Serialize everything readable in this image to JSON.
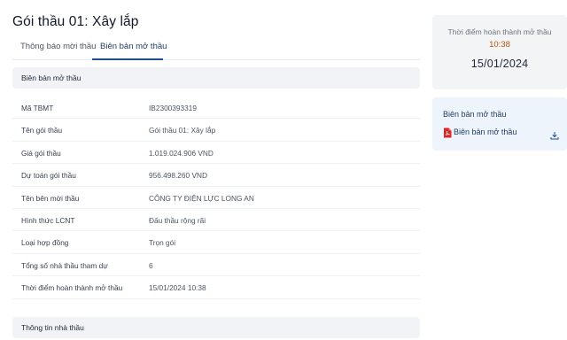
{
  "header": {
    "title": "Gói thầu 01: Xây lắp"
  },
  "tabs": [
    {
      "label": "Thông báo mời thầu",
      "active": false
    },
    {
      "label": "Biên bản mở thầu",
      "active": true
    }
  ],
  "sections": {
    "opening_minutes": "Biên bản mở thầu",
    "bidder_info": "Thông tin nhà thầu"
  },
  "details": [
    {
      "label": "Mã TBMT",
      "value": "IB2300393319"
    },
    {
      "label": "Tên gói thầu",
      "value": "Gói thầu 01: Xây lắp"
    },
    {
      "label": "Giá gói thầu",
      "value": "1.019.024.906 VND"
    },
    {
      "label": "Dự toán gói thầu",
      "value": "956.498.260 VND"
    },
    {
      "label": "Tên bên mời thầu",
      "value": "CÔNG TY ĐIỆN LỰC LONG AN"
    },
    {
      "label": "Hình thức LCNT",
      "value": "Đấu thầu rộng rãi"
    },
    {
      "label": "Loại hợp đồng",
      "value": "Trọn gói"
    },
    {
      "label": "Tổng số nhà thầu tham dự",
      "value": "6"
    },
    {
      "label": "Thời điểm hoàn thành mở thầu",
      "value": "15/01/2024 10:38"
    }
  ],
  "sidebar": {
    "completion": {
      "label": "Thời điểm hoàn thành mở thầu",
      "time": "10:38",
      "date": "15/01/2024"
    },
    "document": {
      "title": "Biên bản mở thầu",
      "link_label": "Biên bản mở thầu",
      "file_icon": "pdf-icon",
      "action_icon": "download-icon"
    }
  },
  "colors": {
    "accent": "#1e4e8c",
    "time": "#b45309",
    "pdf": "#dc2626",
    "section_bg": "#f1f3f6",
    "doc_card_bg": "#eef4fb"
  }
}
